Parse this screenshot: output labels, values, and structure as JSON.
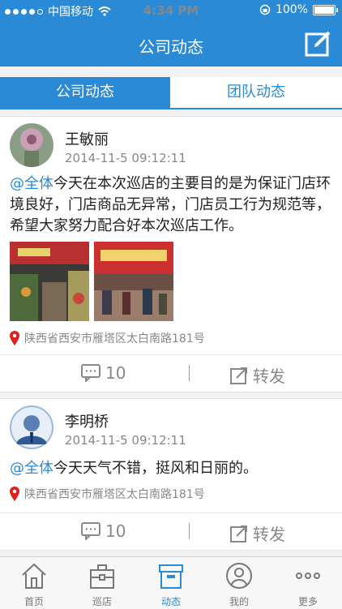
{
  "status": {
    "carrier": "中国移动",
    "time": "4:34 PM",
    "battery": "100%"
  },
  "header": {
    "title": "公司动态"
  },
  "tabs": [
    {
      "label": "公司动态",
      "active": true
    },
    {
      "label": "团队动态",
      "active": false
    }
  ],
  "posts": [
    {
      "author": "王敏丽",
      "time": "2014-11-5  09:12:11",
      "mention": "@全体",
      "text": "今天在本次巡店的主要目的是为保证门店环境良好，门店商品无异常，门店员工行为规范等，希望大家努力配合好本次巡店工作。",
      "location": "陕西省西安市雁塔区太白南路181号",
      "comments": "10",
      "share_label": "转发"
    },
    {
      "author": "李明桥",
      "time": "2014-11-5  09:12:11",
      "mention": "@全体",
      "text": "今天天气不错，挺风和日丽的。",
      "location": "陕西省西安市雁塔区太白南路181号",
      "comments": "10",
      "share_label": "转发"
    }
  ],
  "tabbar": [
    {
      "label": "首页",
      "icon": "home-icon"
    },
    {
      "label": "巡店",
      "icon": "briefcase-icon"
    },
    {
      "label": "动态",
      "icon": "box-icon",
      "active": true
    },
    {
      "label": "我的",
      "icon": "user-icon"
    },
    {
      "label": "更多",
      "icon": "more-icon"
    }
  ],
  "colors": {
    "accent": "#2a8ad6",
    "mention": "#2a8ad6",
    "location_pin": "#e02020"
  }
}
